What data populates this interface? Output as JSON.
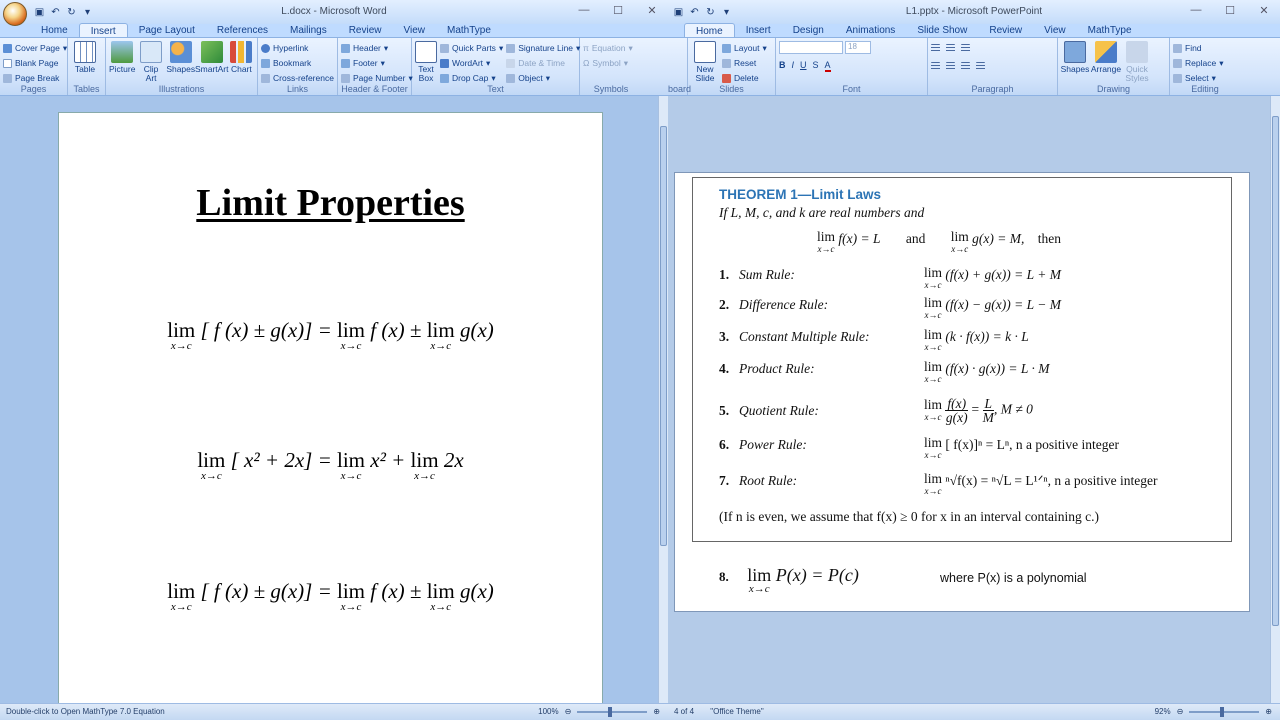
{
  "word": {
    "title": "L.docx - Microsoft Word",
    "tabs": [
      "Home",
      "Insert",
      "Page Layout",
      "References",
      "Mailings",
      "Review",
      "View",
      "MathType"
    ],
    "active_tab": "Insert",
    "groups": {
      "pages": {
        "label": "Pages",
        "items": [
          "Cover Page",
          "Blank Page",
          "Page Break"
        ]
      },
      "tables": {
        "label": "Tables",
        "items": [
          "Table"
        ]
      },
      "illustrations": {
        "label": "Illustrations",
        "items": [
          "Picture",
          "Clip Art",
          "Shapes",
          "SmartArt",
          "Chart"
        ]
      },
      "links": {
        "label": "Links",
        "items": [
          "Hyperlink",
          "Bookmark",
          "Cross-reference"
        ]
      },
      "header_footer": {
        "label": "Header & Footer",
        "items": [
          "Header",
          "Footer",
          "Page Number"
        ]
      },
      "text": {
        "label": "Text",
        "items": [
          "Text Box",
          "Quick Parts",
          "WordArt",
          "Drop Cap",
          "Signature Line",
          "Date & Time",
          "Object"
        ]
      },
      "symbols": {
        "label": "Symbols",
        "items": [
          "Equation",
          "Symbol"
        ]
      }
    },
    "doc_title": "Limit Properties",
    "eq1": {
      "lhs_lim": "lim",
      "lhs_sub": "x→c",
      "lhs_body": "[ f (x) ± g(x)] =",
      "r1_lim": "lim",
      "r1_sub": "x→c",
      "r1_body": "f (x) ±",
      "r2_lim": "lim",
      "r2_sub": "x→c",
      "r2_body": "g(x)"
    },
    "eq2": {
      "lhs_lim": "lim",
      "lhs_sub": "x→c",
      "lhs_body": "[ x² + 2x] =",
      "r1_lim": "lim",
      "r1_sub": "x→c",
      "r1_body": "x² +",
      "r2_lim": "lim",
      "r2_sub": "x→c",
      "r2_body": "2x"
    },
    "eq3": {
      "lhs_lim": "lim",
      "lhs_sub": "x→c",
      "lhs_body": "[ f (x) ± g(x)] =",
      "r1_lim": "lim",
      "r1_sub": "x→c",
      "r1_body": "f (x) ±",
      "r2_lim": "lim",
      "r2_sub": "x→c",
      "r2_body": "g(x)"
    },
    "status": "Double-click to Open MathType 7.0 Equation",
    "zoom": "100%"
  },
  "ppt": {
    "title": "L1.pptx - Microsoft PowerPoint",
    "tabs": [
      "Home",
      "Insert",
      "Design",
      "Animations",
      "Slide Show",
      "Review",
      "View",
      "MathType"
    ],
    "active_tab": "Home",
    "groups": {
      "clipboard": {
        "label": "board"
      },
      "slides": {
        "label": "Slides",
        "items": [
          "New Slide",
          "Layout",
          "Reset",
          "Delete"
        ]
      },
      "font": {
        "label": "Font",
        "size": "18"
      },
      "paragraph": {
        "label": "Paragraph"
      },
      "drawing": {
        "label": "Drawing",
        "items": [
          "Shapes",
          "Arrange",
          "Quick Styles"
        ]
      },
      "editing": {
        "label": "Editing",
        "items": [
          "Find",
          "Replace",
          "Select"
        ]
      }
    },
    "theorem": {
      "heading": "THEOREM 1—Limit Laws",
      "intro": "If L, M, c, and k are real numbers and",
      "given_lim": "lim",
      "given_sub": "x→c",
      "given_f": "f(x) = L",
      "given_and": "and",
      "given_g": "g(x) = M,",
      "given_then": "then",
      "rules": [
        {
          "num": "1.",
          "name": "Sum Rule:",
          "lim": "lim",
          "sub": "x→c",
          "formula": "(f(x) + g(x)) = L + M"
        },
        {
          "num": "2.",
          "name": "Difference Rule:",
          "lim": "lim",
          "sub": "x→c",
          "formula": "(f(x) − g(x)) = L − M"
        },
        {
          "num": "3.",
          "name": "Constant Multiple Rule:",
          "lim": "lim",
          "sub": "x→c",
          "formula": "(k · f(x)) = k · L"
        },
        {
          "num": "4.",
          "name": "Product Rule:",
          "lim": "lim",
          "sub": "x→c",
          "formula": "(f(x) · g(x)) = L · M"
        },
        {
          "num": "5.",
          "name": "Quotient Rule:",
          "lim": "lim",
          "sub": "x→c",
          "fnum": "f(x)",
          "fden": "g(x)",
          "eq": "=",
          "lnum": "L",
          "lden": "M",
          "cond": ",   M ≠ 0"
        },
        {
          "num": "6.",
          "name": "Power Rule:",
          "lim": "lim",
          "sub": "x→c",
          "formula": "[ f(x)]ⁿ = Lⁿ, n a positive integer"
        },
        {
          "num": "7.",
          "name": "Root Rule:",
          "lim": "lim",
          "sub": "x→c",
          "formula": "ⁿ√f(x) = ⁿ√L = L¹ᐟⁿ, n a positive integer"
        }
      ],
      "footnote": "(If n is even, we assume that f(x) ≥ 0 for x in an interval containing c.)"
    },
    "extra": {
      "num": "8.",
      "lim": "lim",
      "sub": "x→c",
      "body": "P(x) = P(c)",
      "note": "where P(x) is a polynomial"
    },
    "status_slide": "4 of 4",
    "status_theme": "\"Office Theme\"",
    "zoom": "92%"
  }
}
